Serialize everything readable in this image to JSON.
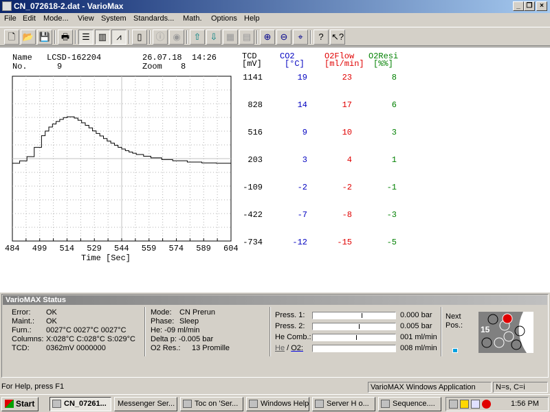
{
  "window": {
    "title": "CN_072618-2.dat - VarioMax"
  },
  "menu": [
    "File",
    "Edit",
    "Mode...",
    "View",
    "System",
    "Standards...",
    "Math.",
    "Options",
    "Help"
  ],
  "info": {
    "name_label": "Name",
    "name_value": "LCSD-162204",
    "no_label": "No.",
    "no_value": "9",
    "date": "26.07.18",
    "time": "14:26",
    "zoom_label": "Zoom",
    "zoom_value": "8"
  },
  "chart_data": {
    "type": "line",
    "xlabel": "Time [Sec]",
    "x_ticks": [
      484,
      499,
      514,
      529,
      544,
      559,
      574,
      589,
      604
    ],
    "xlim": [
      484,
      604
    ],
    "ylim": [
      -734,
      1141
    ],
    "grid": true,
    "series": [
      {
        "name": "TCD",
        "color": "#000000",
        "x": [
          484,
          488,
          492,
          496,
          500,
          502,
          504,
          506,
          508,
          510,
          512,
          514,
          516,
          518,
          520,
          522,
          524,
          526,
          528,
          530,
          532,
          534,
          536,
          538,
          540,
          542,
          544,
          546,
          548,
          550,
          552,
          556,
          560,
          566,
          572,
          580,
          588,
          596,
          604
        ],
        "y": [
          151,
          178,
          226,
          331,
          464,
          517,
          563,
          597,
          626,
          650,
          670,
          679,
          679,
          664,
          640,
          611,
          582,
          553,
          519,
          490,
          461,
          432,
          404,
          380,
          356,
          332,
          313,
          294,
          279,
          265,
          250,
          231,
          212,
          193,
          179,
          164,
          155,
          151,
          149
        ]
      }
    ],
    "y_axes": [
      {
        "name": "TCD",
        "unit": "[mV]",
        "color": "#000000",
        "ticks": [
          "1141",
          "828",
          "516",
          "203",
          "-109",
          "-422",
          "-734"
        ]
      },
      {
        "name": "CO2",
        "unit": "[°C]",
        "color": "#0000c0",
        "ticks": [
          "19",
          "14",
          "9",
          "3",
          "-2",
          "-7",
          "-12"
        ]
      },
      {
        "name": "O2Flow",
        "unit": "[ml/min]",
        "color": "#e00000",
        "ticks": [
          "23",
          "17",
          "10",
          "4",
          "-2",
          "-8",
          "-15"
        ]
      },
      {
        "name": "O2Resi",
        "unit": "[%%]",
        "color": "#008000",
        "ticks": [
          "8",
          "6",
          "3",
          "1",
          "-1",
          "-3",
          "-5"
        ]
      }
    ]
  },
  "status": {
    "header": "VarioMAX Status",
    "error_label": "Error:",
    "error_value": "OK",
    "maint_label": "Maint.:",
    "maint_value": "OK",
    "furn_label": "Furn.:",
    "furn_value": "0027°C  0027°C  0027°C",
    "columns_label": "Columns:",
    "columns_value": "X:028°C C:028°C S:029°C",
    "tcd_label": "TCD:",
    "tcd_value": "0362mV  0000000",
    "mode_label": "Mode:",
    "mode_value": "CN Prerun",
    "phase_label": "Phase:",
    "phase_value": "Sleep",
    "he_label": "He: -09 ml/min",
    "deltap_label": "Delta p: -0.005 bar",
    "o2res_label": "O2 Res.:",
    "o2res_value": "13 Promille",
    "press1_label": "Press. 1:",
    "press1_value": "0.000  bar",
    "press1_level": 0.6,
    "press2_label": "Press. 2:",
    "press2_value": "0.005  bar",
    "press2_level": 0.57,
    "hecomb_label": "He Comb.:",
    "hecomb_value": "001 ml/min",
    "hecomb_level": 0.53,
    "heo2_label_he": "He",
    "heo2_label_sep": "/",
    "heo2_label_o2": "O2:",
    "heo2_value": "008 ml/min",
    "heo2_level": 0.0,
    "next_label": "Next",
    "pos_label": "Pos.:",
    "carousel_number": "15"
  },
  "statusbar": {
    "help": "For Help, press F1",
    "app": "VarioMAX Windows Application",
    "mode": "N=s, C=i"
  },
  "taskbar": {
    "start": "Start",
    "tasks": [
      "CN_07261...",
      "Messenger Ser...",
      "Toc on 'Ser...",
      "Windows Help",
      "Server H o...",
      "Sequence...."
    ],
    "clock": "1:56 PM"
  }
}
